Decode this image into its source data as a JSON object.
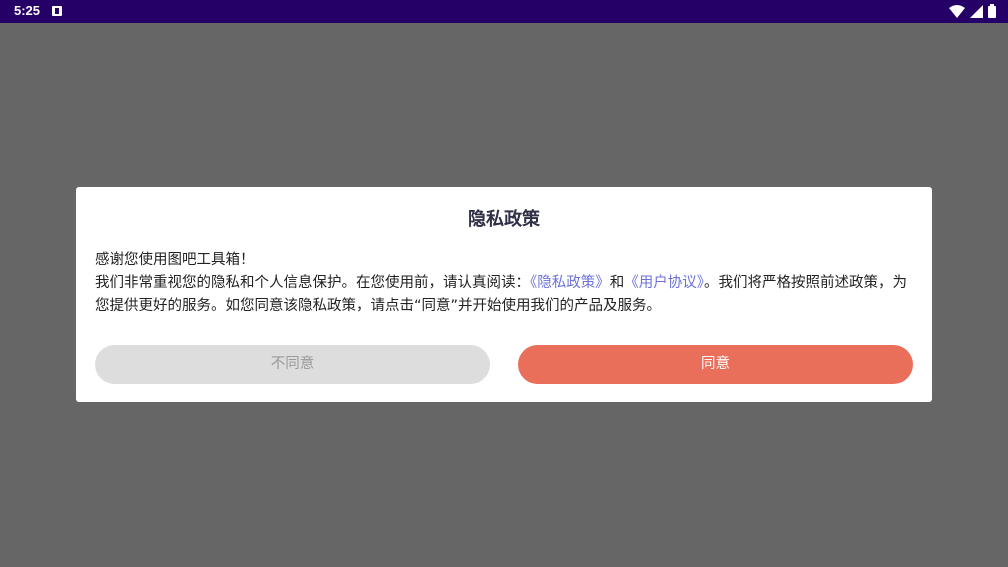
{
  "status_bar": {
    "time": "5:25",
    "notification_icon": "accessibility-notification-icon",
    "wifi_icon": "wifi-icon",
    "signal_icon": "cell-signal-icon",
    "battery_icon": "battery-icon"
  },
  "dialog": {
    "title": "隐私政策",
    "line1": "感谢您使用图吧工具箱！",
    "line2_prefix": "我们非常重视您的隐私和个人信息保护。在您使用前，请认真阅读：",
    "privacy_link": "《隐私政策》",
    "and": "和",
    "user_link": "《用户协议》",
    "line2_suffix": "。我们将严格按照前述政策，为您提供更好的服务。如您同意该隐私政策，请点击“同意”并开始使用我们的产品及服务。",
    "disagree_label": "不同意",
    "agree_label": "同意"
  },
  "colors": {
    "status_bar": "#250066",
    "scrim": "#666666",
    "link": "#6c72d8",
    "agree_button": "#ea6f5b",
    "disagree_button": "#dddddd"
  }
}
